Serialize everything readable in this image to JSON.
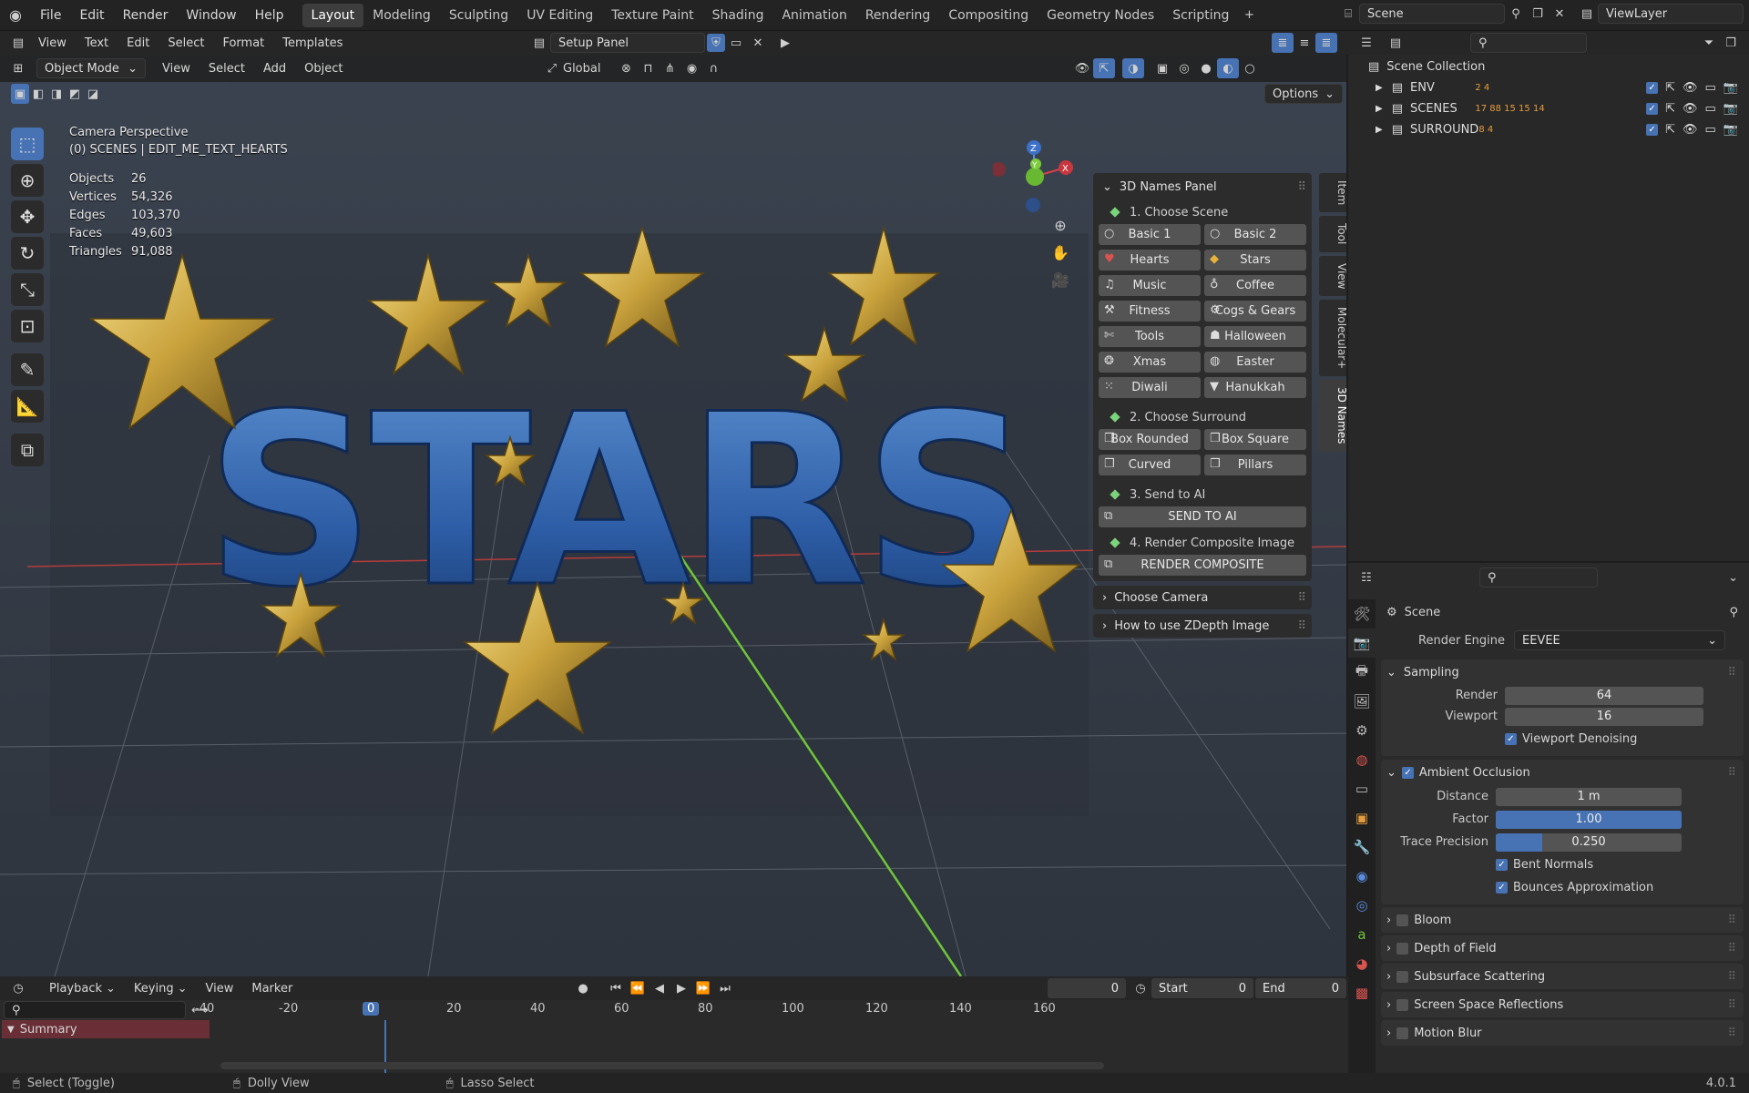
{
  "app": {
    "logo": "blender-icon"
  },
  "menus": [
    "File",
    "Edit",
    "Render",
    "Window",
    "Help"
  ],
  "workspaces": [
    "Layout",
    "Modeling",
    "Sculpting",
    "UV Editing",
    "Texture Paint",
    "Shading",
    "Animation",
    "Rendering",
    "Compositing",
    "Geometry Nodes",
    "Scripting"
  ],
  "active_workspace": "Layout",
  "scene": {
    "name": "Scene",
    "viewlayer": "ViewLayer"
  },
  "text_editor": {
    "menus": [
      "View",
      "Text",
      "Edit",
      "Select",
      "Format",
      "Templates"
    ],
    "file": "Setup Panel"
  },
  "viewport": {
    "mode": "Object Mode",
    "menus": [
      "View",
      "Select",
      "Add",
      "Object"
    ],
    "orientation": "Global",
    "options_label": "Options",
    "overlay_title": "Camera Perspective",
    "overlay_sub": "(0) SCENES | EDIT_ME_TEXT_HEARTS",
    "stats": [
      {
        "label": "Objects",
        "value": "26"
      },
      {
        "label": "Vertices",
        "value": "54,326"
      },
      {
        "label": "Edges",
        "value": "103,370"
      },
      {
        "label": "Faces",
        "value": "49,603"
      },
      {
        "label": "Triangles",
        "value": "91,088"
      }
    ],
    "scene_text": "STARS",
    "gizmo": {
      "x": "X",
      "y": "Y",
      "z": "Z"
    }
  },
  "npanel": {
    "title": "3D Names Panel",
    "step1": "1. Choose Scene",
    "scenes": [
      {
        "label": "Basic 1",
        "icon": "circle-icon"
      },
      {
        "label": "Basic 2",
        "icon": "circle-icon"
      },
      {
        "label": "Hearts",
        "icon": "heart-icon"
      },
      {
        "label": "Stars",
        "icon": "star-icon"
      },
      {
        "label": "Music",
        "icon": "music-note-icon"
      },
      {
        "label": "Coffee",
        "icon": "drop-icon"
      },
      {
        "label": "Fitness",
        "icon": "dumbbell-icon"
      },
      {
        "label": "Cogs & Gears",
        "icon": "gear-icon"
      },
      {
        "label": "Tools",
        "icon": "wrench-icon"
      },
      {
        "label": "Halloween",
        "icon": "ghost-icon"
      },
      {
        "label": "Xmas",
        "icon": "ornament-icon"
      },
      {
        "label": "Easter",
        "icon": "egg-icon"
      },
      {
        "label": "Diwali",
        "icon": "lamp-icon"
      },
      {
        "label": "Hanukkah",
        "icon": "menorah-icon"
      }
    ],
    "step2": "2. Choose Surround",
    "surrounds": [
      "Box Rounded",
      "Box Square",
      "Curved",
      "Pillars"
    ],
    "step3": "3. Send to AI",
    "send_button": "SEND TO AI",
    "step4": "4. Render Composite Image",
    "render_button": "RENDER COMPOSITE",
    "collapsed": [
      "Choose Camera",
      "How to use ZDepth Image"
    ],
    "tabs": [
      "Item",
      "Tool",
      "View",
      "Molecular+",
      "3D Names"
    ]
  },
  "outliner": {
    "root": "Scene Collection",
    "items": [
      {
        "name": "ENV",
        "badges": "2 4"
      },
      {
        "name": "SCENES",
        "badges": "17 88 15 15 14"
      },
      {
        "name": "SURROUND",
        "badges": "8 4"
      }
    ]
  },
  "properties": {
    "context": "Scene",
    "render_engine_label": "Render Engine",
    "render_engine": "EEVEE",
    "sampling": {
      "title": "Sampling",
      "render_label": "Render",
      "render": "64",
      "viewport_label": "Viewport",
      "viewport": "16",
      "denoise": "Viewport Denoising"
    },
    "ao": {
      "title": "Ambient Occlusion",
      "distance_label": "Distance",
      "distance": "1 m",
      "factor_label": "Factor",
      "factor": "1.00",
      "factor_fill": 1.0,
      "trace_label": "Trace Precision",
      "trace": "0.250",
      "trace_fill": 0.25,
      "bent": "Bent Normals",
      "bounces": "Bounces Approximation"
    },
    "sections": [
      "Bloom",
      "Depth of Field",
      "Subsurface Scattering",
      "Screen Space Reflections",
      "Motion Blur"
    ]
  },
  "timeline": {
    "menus": [
      "Playback",
      "Keying",
      "View",
      "Marker"
    ],
    "frame": "0",
    "start_label": "Start",
    "start": "0",
    "end_label": "End",
    "end": "0",
    "ticks": [
      "-40",
      "-20",
      "0",
      "20",
      "40",
      "60",
      "80",
      "100",
      "120",
      "140",
      "160"
    ],
    "summary": "Summary"
  },
  "status": {
    "left": "Select (Toggle)",
    "mid": "Dolly View",
    "right": "Lasso Select",
    "version": "4.0.1"
  }
}
